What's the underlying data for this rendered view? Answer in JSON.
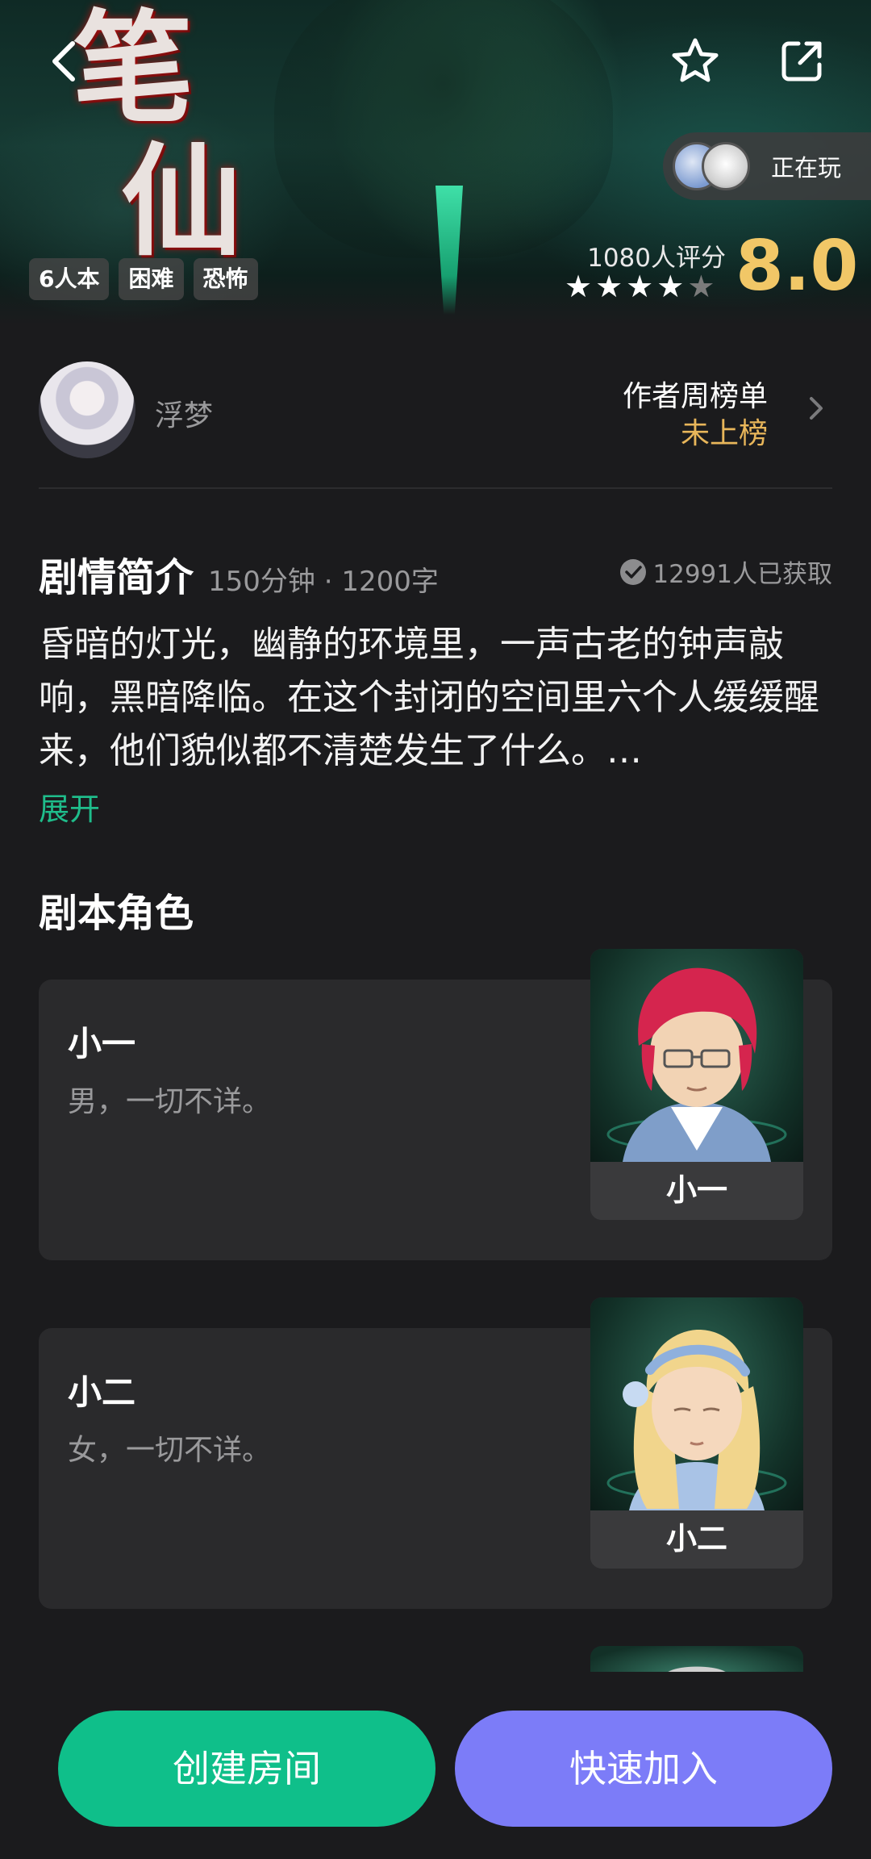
{
  "hero": {
    "title_chars": [
      "笔",
      "仙"
    ],
    "tags": [
      "6人本",
      "困难",
      "恐怖"
    ],
    "playing_label": "正在玩",
    "rating": {
      "count_label": "1080人评分",
      "score": "8.0",
      "stars_filled": 4,
      "stars_total": 5
    },
    "icons": {
      "back": "chevron-left-icon",
      "favorite": "star-outline-icon",
      "share": "share-external-icon"
    }
  },
  "author": {
    "name": "浮梦",
    "rank_title": "作者周榜单",
    "rank_status": "未上榜"
  },
  "synopsis": {
    "title": "剧情简介",
    "meta": "150分钟 · 1200字",
    "acquired": "12991人已获取",
    "body": "昏暗的灯光，幽静的环境里，一声古老的钟声敲响，黑暗降临。在这个封闭的空间里六个人缓缓醒来，他们貌似都不清楚发生了什么。…",
    "expand_label": "展开"
  },
  "roles": {
    "title": "剧本角色",
    "items": [
      {
        "name": "小一",
        "desc": "男，一切不详。",
        "thumb_label": "小一"
      },
      {
        "name": "小二",
        "desc": "女，一切不详。",
        "thumb_label": "小二"
      }
    ]
  },
  "actions": {
    "create_room": "创建房间",
    "quick_join": "快速加入"
  },
  "colors": {
    "background": "#1b1b1d",
    "card": "#2a2a2c",
    "score_gold": "#f1c767",
    "rank_gold": "#e8b65a",
    "expand_green": "#1fbd8b",
    "create_green": "#0fbf8a",
    "join_purple": "#7c7cf8"
  }
}
